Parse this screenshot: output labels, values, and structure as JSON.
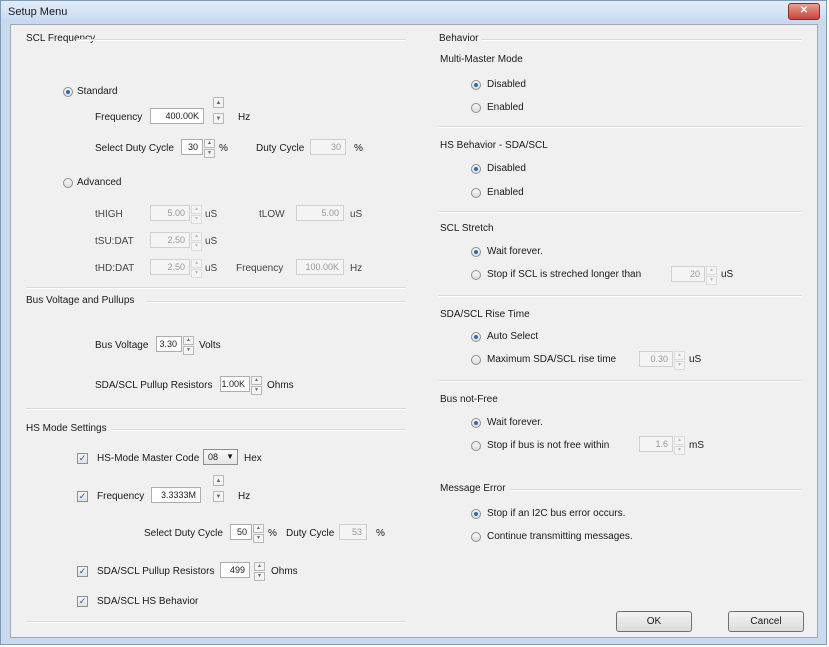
{
  "window": {
    "title": "Setup Menu",
    "close_label": "✕"
  },
  "scl_frequency": {
    "title": "SCL Frequency",
    "standard_label": "Standard",
    "frequency_label": "Frequency",
    "frequency_value": "400.00K",
    "hz": "Hz",
    "select_duty_label": "Select Duty Cycle",
    "duty_select_value": "30",
    "percent": "%",
    "duty_cycle_label": "Duty Cycle",
    "duty_cycle_value": "30",
    "advanced_label": "Advanced",
    "thigh_label": "tHIGH",
    "thigh_value": "5.00",
    "us": "uS",
    "tlow_label": "tLOW",
    "tlow_value": "5.00",
    "tsudat_label": "tSU:DAT",
    "tsudat_value": "2.50",
    "thddat_label": "tHD:DAT",
    "thddat_value": "2.50",
    "adv_frequency_label": "Frequency",
    "adv_frequency_value": "100.00K"
  },
  "bus_voltage": {
    "title": "Bus Voltage and Pullups",
    "bus_voltage_label": "Bus Voltage",
    "bus_voltage_value": "3.30",
    "volts": "Volts",
    "pullup_label": "SDA/SCL Pullup Resistors",
    "pullup_value": "1.00K",
    "ohms": "Ohms"
  },
  "hs_mode": {
    "title": "HS Mode Settings",
    "master_code_label": "HS-Mode Master Code",
    "master_code_value": "08",
    "hex": "Hex",
    "frequency_label": "Frequency",
    "frequency_value": "3.3333M",
    "hz": "Hz",
    "select_duty_label": "Select Duty Cycle",
    "duty_select_value": "50",
    "percent": "%",
    "duty_cycle_label": "Duty Cycle",
    "duty_cycle_value": "53",
    "pullup_label": "SDA/SCL Pullup Resistors",
    "pullup_value": "499",
    "ohms": "Ohms",
    "hs_behavior_label": "SDA/SCL HS Behavior"
  },
  "behavior": {
    "title": "Behavior",
    "multi_master": {
      "title": "Multi-Master Mode",
      "disabled": "Disabled",
      "enabled": "Enabled"
    },
    "hs_behavior": {
      "title": "HS Behavior - SDA/SCL",
      "disabled": "Disabled",
      "enabled": "Enabled"
    },
    "scl_stretch": {
      "title": "SCL Stretch",
      "wait": "Wait forever.",
      "stop": "Stop if SCL is streched longer than",
      "value": "20",
      "unit": "uS"
    },
    "rise_time": {
      "title": "SDA/SCL Rise Time",
      "auto": "Auto Select",
      "max": "Maximum SDA/SCL rise time",
      "value": "0.30",
      "unit": "uS"
    },
    "bus_not_free": {
      "title": "Bus not-Free",
      "wait": "Wait forever.",
      "stop": "Stop if bus is not free within",
      "value": "1.6",
      "unit": "mS"
    },
    "message_error": {
      "title": "Message Error",
      "stop": "Stop if an I2C bus error occurs.",
      "continue": "Continue transmitting messages."
    }
  },
  "buttons": {
    "ok": "OK",
    "cancel": "Cancel"
  },
  "icons": {
    "check": "✓",
    "up": "▲",
    "down": "▼"
  }
}
